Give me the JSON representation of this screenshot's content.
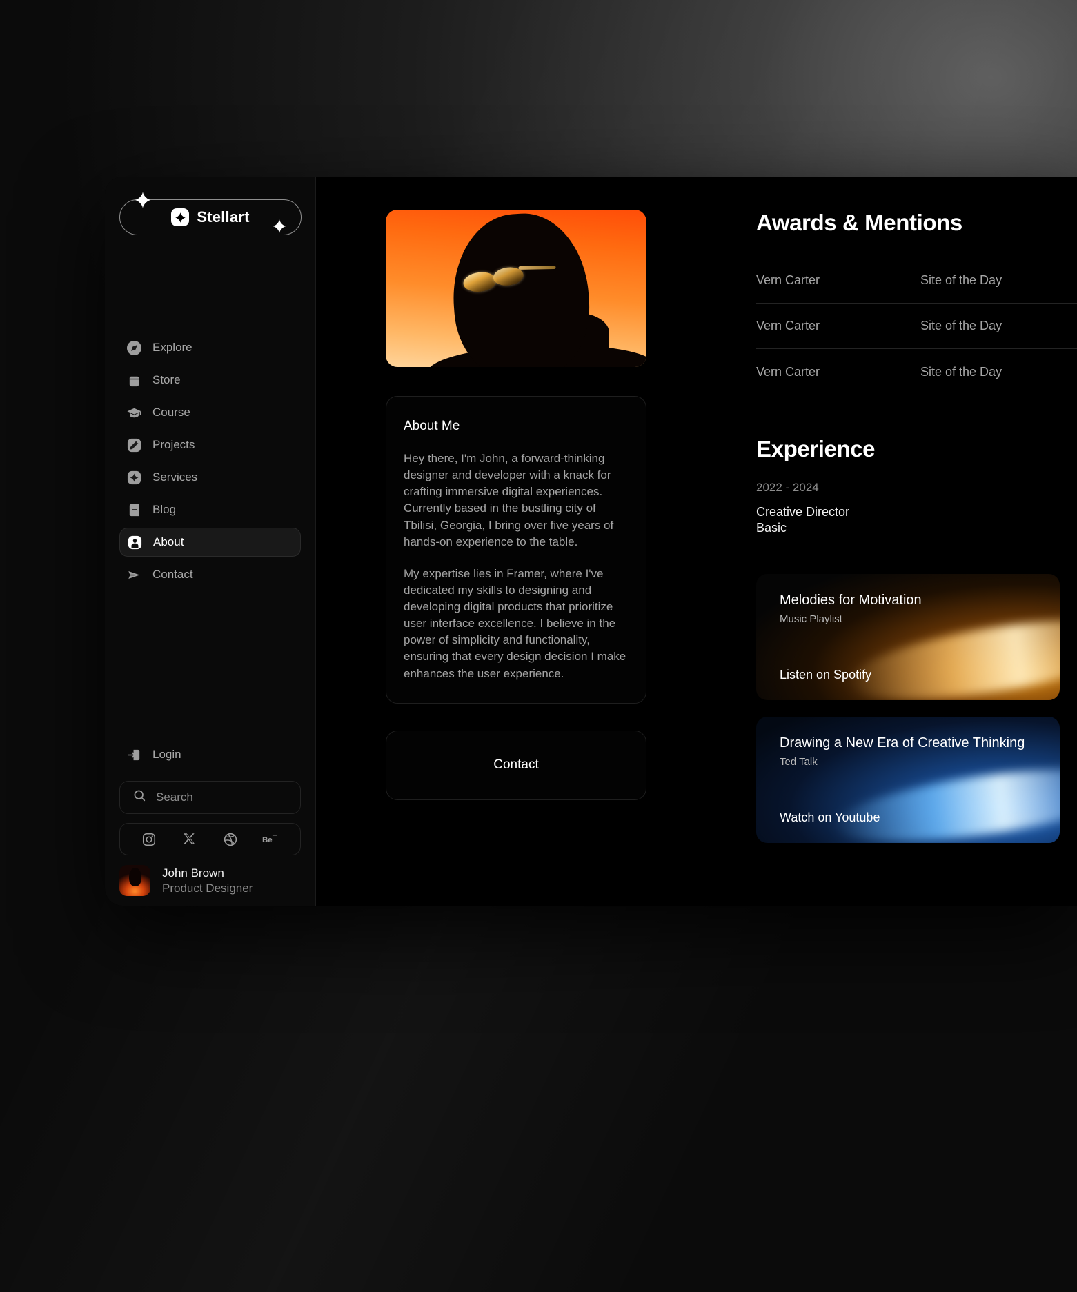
{
  "brand": {
    "name": "Stellart",
    "logo_icon": "sparkle-icon"
  },
  "sidebar": {
    "nav": [
      {
        "label": "Explore",
        "icon": "compass-icon",
        "active": false
      },
      {
        "label": "Store",
        "icon": "bag-icon",
        "active": false
      },
      {
        "label": "Course",
        "icon": "graduation-cap-icon",
        "active": false
      },
      {
        "label": "Projects",
        "icon": "pencil-icon",
        "active": false
      },
      {
        "label": "Services",
        "icon": "sparkle-icon",
        "active": false
      },
      {
        "label": "Blog",
        "icon": "book-icon",
        "active": false
      },
      {
        "label": "About",
        "icon": "user-icon",
        "active": true
      },
      {
        "label": "Contact",
        "icon": "send-icon",
        "active": false
      }
    ],
    "login": {
      "label": "Login",
      "icon": "login-arrow-icon"
    },
    "search": {
      "placeholder": "Search",
      "icon": "search-icon"
    },
    "socials": [
      {
        "name": "instagram-icon"
      },
      {
        "name": "x-twitter-icon"
      },
      {
        "name": "dribbble-icon"
      },
      {
        "name": "behance-icon"
      }
    ],
    "profile": {
      "name": "John Brown",
      "role": "Product Designer"
    }
  },
  "main": {
    "hero": {
      "alt": "portrait-silhouette-with-sunglasses"
    },
    "about": {
      "title": "About Me",
      "paragraph1": "Hey there, I'm John, a forward-thinking designer and developer with a knack for crafting immersive digital experiences. Currently based in the bustling city of Tbilisi, Georgia, I bring over five years of hands-on experience to the table.",
      "paragraph2": "My expertise lies in Framer, where I've dedicated my skills to designing and developing digital products that prioritize user interface excellence. I believe in the power of simplicity and functionality, ensuring that every design decision I make enhances the user experience."
    },
    "contact_button": "Contact"
  },
  "right": {
    "awards": {
      "title": "Awards & Mentions",
      "rows": [
        {
          "name": "Vern Carter",
          "site": "Site of the Day"
        },
        {
          "name": "Vern Carter",
          "site": "Site of the Day"
        },
        {
          "name": "Vern Carter",
          "site": "Site of the Day"
        }
      ]
    },
    "experience": {
      "title": "Experience",
      "date": "2022 - 2024",
      "role": "Creative Director",
      "company": "Basic"
    },
    "media": [
      {
        "title": "Melodies for Motivation",
        "subtitle": "Music Playlist",
        "cta": "Listen  on Spotify",
        "theme": "orange"
      },
      {
        "title": "Drawing a New Era of Creative Thinking",
        "subtitle": "Ted Talk",
        "cta": "Watch on Youtube",
        "theme": "blue"
      }
    ]
  },
  "colors": {
    "accent_orange": "#ff8c2a",
    "accent_blue": "#2f7ddb",
    "surface": "#0a0a0a",
    "text_primary": "#ffffff",
    "text_muted": "#a5a5a5"
  }
}
